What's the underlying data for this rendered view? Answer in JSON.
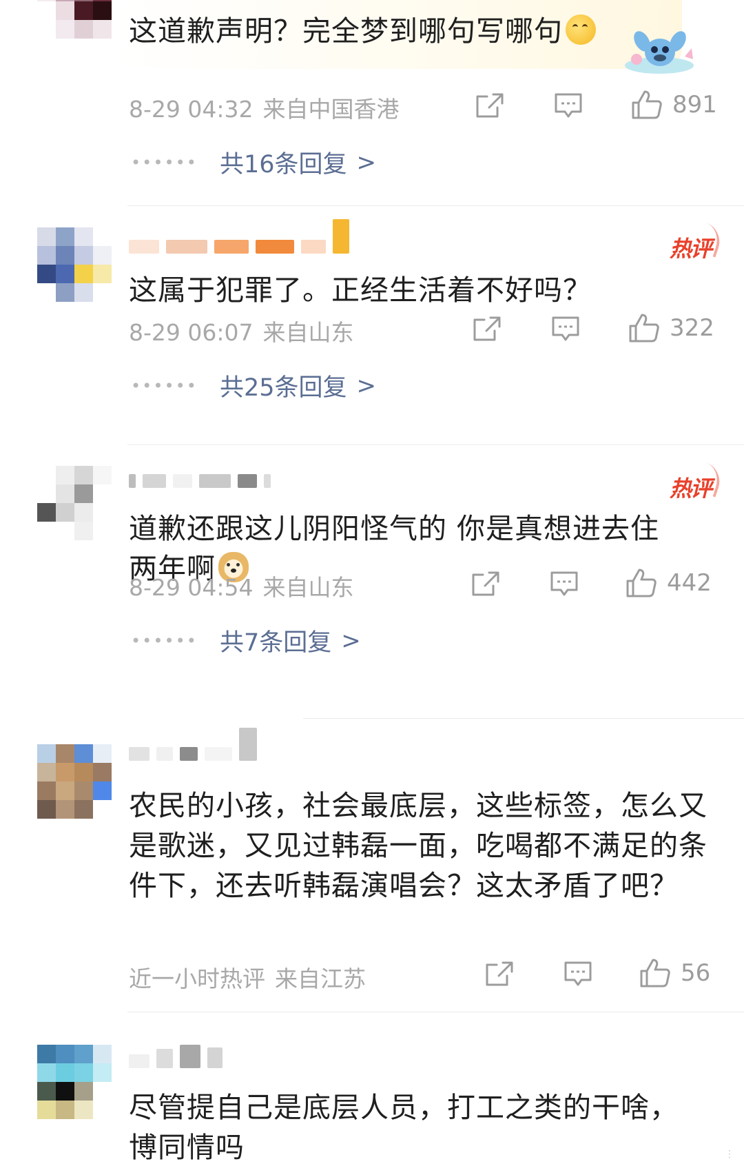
{
  "comments": [
    {
      "text": "这道歉声明？完全梦到哪句写哪句",
      "time": "8-29 04:32",
      "location": "来自中国香港",
      "likes": "891",
      "replies": "共16条回复",
      "hot": false,
      "emoji": "thinking-emoji"
    },
    {
      "text": "这属于犯罪了。正经生活着不好吗？",
      "time": "8-29 06:07",
      "location": "来自山东",
      "likes": "322",
      "replies": "共25条回复",
      "hot": true,
      "hot_label": "热评"
    },
    {
      "text": "道歉还跟这儿阴阳怪气的 你是真想进去住两年啊",
      "time": "8-29 04:54",
      "location": "来自山东",
      "likes": "442",
      "replies": "共7条回复",
      "hot": true,
      "hot_label": "热评",
      "emoji": "doge-emoji"
    },
    {
      "text": "农民的小孩，社会最底层，这些标签，怎么又是歌迷，又见过韩磊一面，吃喝都不满足的条件下，还去听韩磊演唱会？这太矛盾了吧？",
      "time": "近一小时热评",
      "location": "来自江苏",
      "likes": "56",
      "hot": false
    },
    {
      "text": "尽管提自己是底层人员，打工之类的干啥，博同情吗",
      "hot": false
    }
  ],
  "colors": {
    "hot_red": "#e8412b",
    "reply_link": "#5b6e93",
    "meta_gray": "#a8a8a8"
  }
}
